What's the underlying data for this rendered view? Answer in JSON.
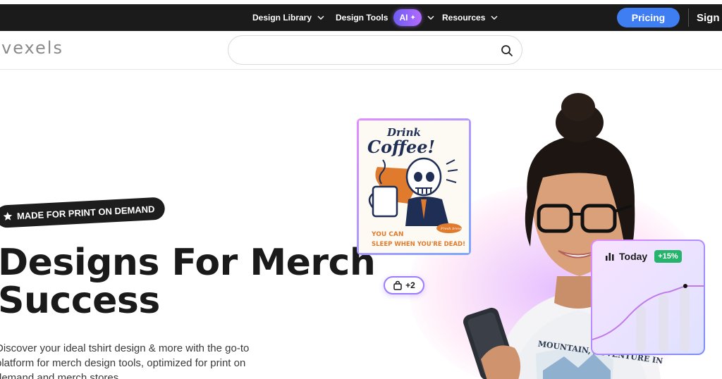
{
  "nav": {
    "items": [
      {
        "label": "Design Library",
        "icon": "chevron-down-icon"
      },
      {
        "label": "Design Tools",
        "icon": "chevron-down-icon",
        "badge": "AI"
      },
      {
        "label": "Resources",
        "icon": "chevron-down-icon"
      }
    ],
    "pricing_label": "Pricing",
    "signin_label": "Sign u"
  },
  "header": {
    "logo_text": "vexels",
    "search_placeholder": "",
    "search_icon": "search-icon"
  },
  "hero": {
    "badge_label": "MADE FOR PRINT ON DEMAND",
    "badge_icon": "star-icon",
    "headline_line1": "Designs For Merch",
    "headline_line2": "Success",
    "description": "Discover your ideal tshirt design & more with the go-to platform for merch design tools, optimized for print on demand and merch stores"
  },
  "coffee_design": {
    "line1": "Drink",
    "line2": "Coffee!",
    "tagline1": "YOU CAN",
    "tagline2": "SLEEP WHEN YOU'RE DEAD!",
    "stamp": "Fresh brewed"
  },
  "cart_pill": {
    "icon": "shopping-bag-icon",
    "count": "+2"
  },
  "shirt_text": "MOUNTAIN, ADVENTURE IN",
  "stat_card": {
    "icon": "bar-chart-icon",
    "title": "Today",
    "change": "+15%"
  },
  "colors": {
    "navbar": "#1b1b1b",
    "pricing": "#3f7df3",
    "ai_badge": "#8a63f5",
    "stat_change": "#26b36b",
    "card_border": "#e38bff"
  }
}
